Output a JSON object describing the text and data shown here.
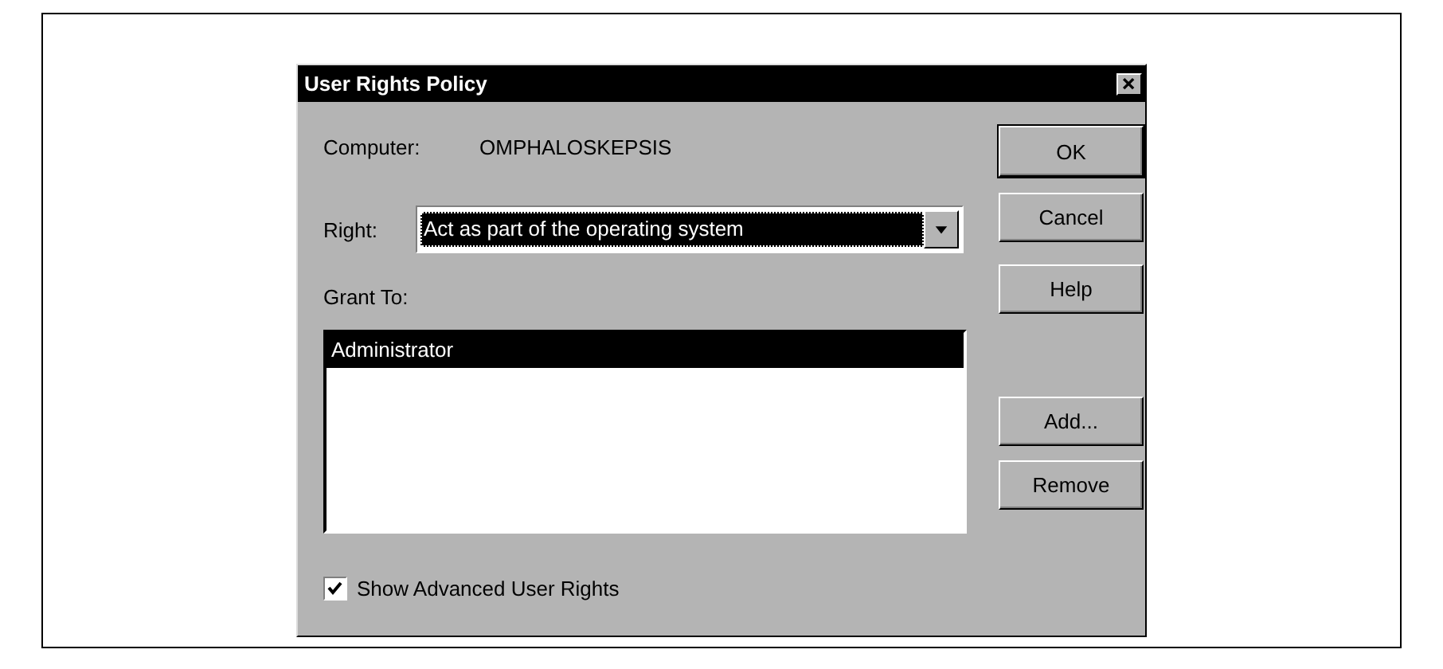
{
  "window": {
    "title": "User Rights Policy"
  },
  "computer": {
    "label": "Computer:",
    "value": "OMPHALOSKEPSIS"
  },
  "right": {
    "label": "Right:",
    "value": "Act as part of the operating system"
  },
  "grant_to": {
    "label": "Grant To:",
    "items": [
      {
        "name": "Administrator",
        "selected": true
      }
    ]
  },
  "buttons": [
    {
      "label": "OK",
      "default": true
    },
    {
      "label": "Cancel",
      "default": false
    },
    {
      "label": "Help",
      "default": false
    }
  ],
  "list_buttons": [
    {
      "label": "Add..."
    },
    {
      "label": "Remove"
    }
  ],
  "show_advanced": {
    "label": "Show Advanced User Rights",
    "checked": true
  }
}
